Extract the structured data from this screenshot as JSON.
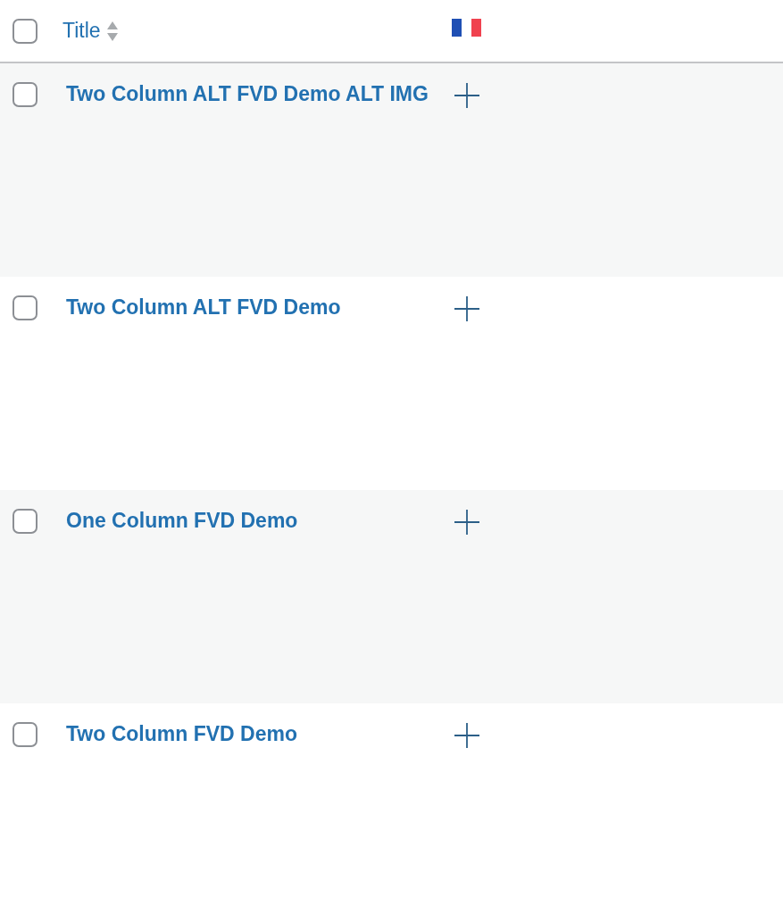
{
  "header": {
    "checked": false,
    "title": "Title"
  },
  "rows": [
    {
      "checked": false,
      "title": "Two Column ALT FVD Demo ALT IMG"
    },
    {
      "checked": false,
      "title": "Two Column ALT FVD Demo"
    },
    {
      "checked": false,
      "title": "One Column FVD Demo"
    },
    {
      "checked": false,
      "title": "Two Column FVD Demo"
    }
  ]
}
